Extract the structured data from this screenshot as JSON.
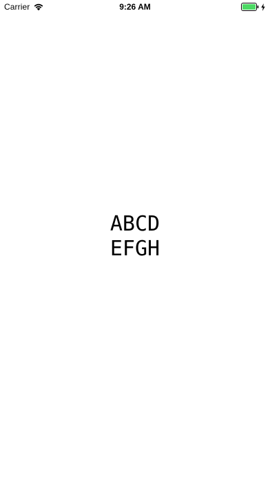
{
  "status_bar": {
    "carrier": "Carrier",
    "time": "9:26 AM",
    "wifi_icon": "wifi-icon",
    "battery_icon": "battery-icon",
    "charging_icon": "charging-bolt-icon",
    "battery_color": "#4cd964"
  },
  "main": {
    "lines": [
      "ABCD",
      "EFGH"
    ]
  }
}
